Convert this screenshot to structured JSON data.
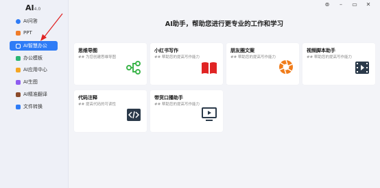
{
  "app": {
    "logo": "AI",
    "version": "4.0"
  },
  "window_controls": {
    "pin": "⊚",
    "minimize": "–",
    "restore": "▭",
    "close": "✕"
  },
  "sidebar": {
    "items": [
      {
        "label": "AI问答",
        "icon": "chat-icon",
        "color": "#2f7cf6"
      },
      {
        "label": "PPT",
        "icon": "ppt-icon",
        "color": "#f07c2a"
      },
      {
        "label": "AI智慧办公",
        "icon": "edit-icon",
        "color": "#ffffff",
        "active": true
      },
      {
        "label": "办公模板",
        "icon": "template-icon",
        "color": "#2bb673"
      },
      {
        "label": "AI应用中心",
        "icon": "apps-icon",
        "color": "#f5a623"
      },
      {
        "label": "AI生图",
        "icon": "image-icon",
        "color": "#8e5cf0"
      },
      {
        "label": "AI精准翻译",
        "icon": "book-icon",
        "color": "#8b4a2b"
      },
      {
        "label": "文件转换",
        "icon": "file-icon",
        "color": "#2f7cf6"
      }
    ]
  },
  "main": {
    "title": "AI助手，帮助您进行更专业的工作和学习",
    "cards": [
      {
        "title": "思维导图",
        "desc": "## 为您创建思维导图",
        "icon": "mindmap-icon",
        "color": "#3bb44a"
      },
      {
        "title": "小红书写作",
        "desc": "## 帮助您的提高写作能力",
        "icon": "open-book-icon",
        "color": "#e02424"
      },
      {
        "title": "朋友圈文案",
        "desc": "## 帮助您的提高写作能力",
        "icon": "aperture-icon",
        "color": "#f07c1a"
      },
      {
        "title": "视频脚本助手",
        "desc": "## 帮助您的提高写作能力",
        "icon": "film-icon",
        "color": "#2b3a4a"
      },
      {
        "title": "代码注释",
        "desc": "## 提高代码的可读性",
        "icon": "code-icon",
        "color": "#2b3a4a"
      },
      {
        "title": "带货口播助手",
        "desc": "## 帮助您的提高写作能力",
        "icon": "play-screen-icon",
        "color": "#2b3a4a"
      }
    ]
  }
}
